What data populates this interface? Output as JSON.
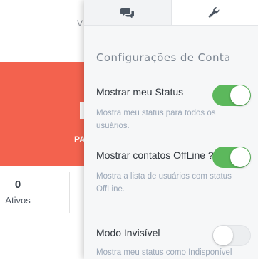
{
  "background": {
    "topbar_fragment": "V",
    "card_fragment": "PA",
    "stat": {
      "value": "0",
      "label": "Ativos"
    },
    "colors": {
      "card": "#f3624e"
    }
  },
  "panel": {
    "tabs": [
      {
        "icon": "chat-bubbles-icon",
        "active": true
      },
      {
        "icon": "wrench-icon",
        "active": false
      }
    ],
    "title": "Configurações de Conta",
    "settings": [
      {
        "label": "Mostrar meu Status",
        "description": "Mostra meu status para todos os usuários.",
        "enabled": true
      },
      {
        "label": "Mostrar contatos OffLine ?",
        "description": "Mostra a lista de usuários com status OffLine.",
        "enabled": true
      },
      {
        "label": "Modo Invisível",
        "description": "Mostra meu status como Indisponível",
        "enabled": false
      }
    ],
    "colors": {
      "toggle_on": "#5cb85c",
      "toggle_off": "#eceef0",
      "title": "#7a8490",
      "description": "#9aa6b6"
    }
  }
}
